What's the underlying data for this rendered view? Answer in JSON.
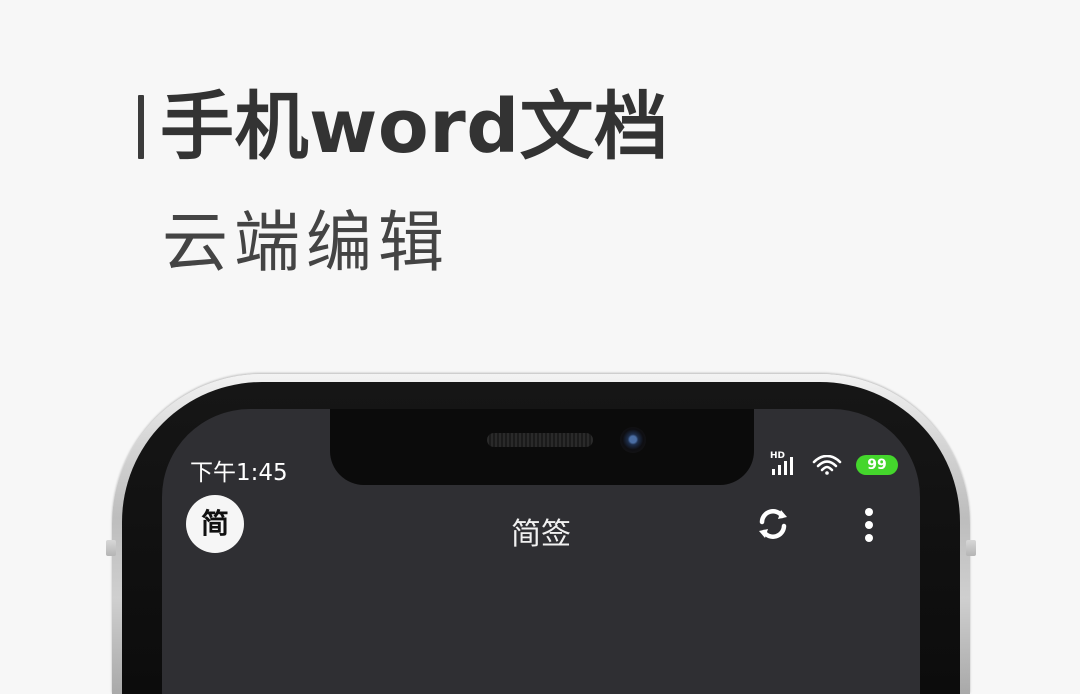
{
  "headline": {
    "title": "手机word文档",
    "subtitle": "云端编辑"
  },
  "status_bar": {
    "time": "下午1:45",
    "signal_label": "HD",
    "battery": "99",
    "icons": [
      "signal-icon",
      "wifi-icon",
      "battery-icon"
    ]
  },
  "toolbar": {
    "app_icon_label": "简",
    "title": "简签",
    "sync_icon": "sync-icon",
    "more_icon": "more-vertical-icon"
  },
  "colors": {
    "background": "#f7f7f7",
    "headline_text": "#333333",
    "screen_bg": "#2f2f33",
    "battery_green": "#44d62c",
    "icon_white": "#ffffff"
  }
}
